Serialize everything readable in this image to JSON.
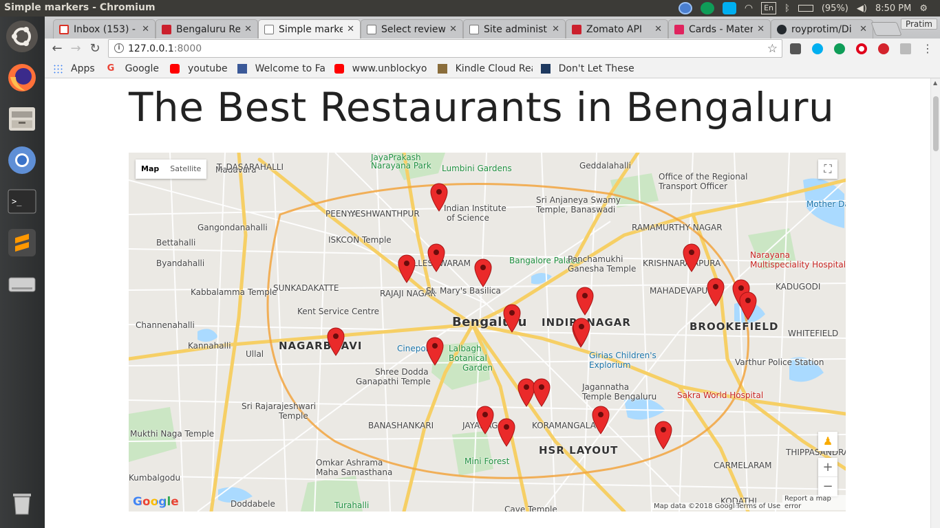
{
  "topbar": {
    "window_title": "Simple markers - Chromium",
    "keyboard": "En",
    "battery": "(95%)",
    "clock": "8:50 PM"
  },
  "tabs": [
    {
      "label": "Inbox (153) - p",
      "color": "#d93025"
    },
    {
      "label": "Bengaluru Re",
      "color": "#cb202d"
    },
    {
      "label": "Simple marke",
      "color": "#ffffff",
      "active": true
    },
    {
      "label": "Select review",
      "color": "#ffffff"
    },
    {
      "label": "Site administ",
      "color": "#ffffff"
    },
    {
      "label": "Zomato API",
      "color": "#cb202d"
    },
    {
      "label": "Cards - Mater",
      "color": "#e0245e"
    },
    {
      "label": "royprotim/Di",
      "color": "#24292e"
    }
  ],
  "profile": "Pratim",
  "address": {
    "host": "127.0.0.1",
    "port": ":8000"
  },
  "bookmarks": [
    {
      "label": "Apps",
      "color": "#4285f4"
    },
    {
      "label": "Google",
      "color": "#ea4335"
    },
    {
      "label": "youtube",
      "color": "#ff0000"
    },
    {
      "label": "Welcome to Face",
      "color": "#3b5998"
    },
    {
      "label": "www.unblockyo",
      "color": "#ff0000"
    },
    {
      "label": "Kindle Cloud Rea",
      "color": "#8a6d3b"
    },
    {
      "label": "Don't Let These",
      "color": "#1f3a60"
    }
  ],
  "page": {
    "title": "The Best Restaurants in Bengaluru"
  },
  "map": {
    "type_control": {
      "map": "Map",
      "satellite": "Satellite"
    },
    "labels": [
      {
        "text": "JayaPrakash",
        "cls": "green"
      },
      {
        "text": "Narayana Park",
        "cls": "green"
      },
      {
        "text": "Lumbini Gardens",
        "cls": "green"
      },
      {
        "text": "Geddalahalli",
        "cls": ""
      },
      {
        "text": "Office of the Regional",
        "cls": ""
      },
      {
        "text": "Transport Officer",
        "cls": ""
      },
      {
        "text": "Madavara",
        "cls": ""
      },
      {
        "text": "T. DASARAHALLI",
        "cls": ""
      },
      {
        "text": "Indian Institute",
        "cls": ""
      },
      {
        "text": "of Science",
        "cls": ""
      },
      {
        "text": "Sri Anjaneya Swamy",
        "cls": ""
      },
      {
        "text": "Temple, Banaswadi",
        "cls": ""
      },
      {
        "text": "Mother Dairy",
        "cls": "blue"
      },
      {
        "text": "Gangondanahalli",
        "cls": ""
      },
      {
        "text": "PEENYA",
        "cls": ""
      },
      {
        "text": "YESHWANTHPUR",
        "cls": ""
      },
      {
        "text": "RAMAMURTHY NAGAR",
        "cls": ""
      },
      {
        "text": "Bettahalli",
        "cls": ""
      },
      {
        "text": "ISKCON Temple",
        "cls": ""
      },
      {
        "text": "Bangalore Palace",
        "cls": "green"
      },
      {
        "text": "Panchamukhi",
        "cls": ""
      },
      {
        "text": "Ganesha Temple",
        "cls": ""
      },
      {
        "text": "Narayana",
        "cls": "red"
      },
      {
        "text": "Multispeciality Hospital",
        "cls": "red"
      },
      {
        "text": "Byandahalli",
        "cls": ""
      },
      {
        "text": "MALLESHWARAM",
        "cls": ""
      },
      {
        "text": "KRISHNARAJAPURA",
        "cls": ""
      },
      {
        "text": "Kabbalamma Temple",
        "cls": ""
      },
      {
        "text": "SUNKADAKATTE",
        "cls": ""
      },
      {
        "text": "RAJAJI NAGAR",
        "cls": ""
      },
      {
        "text": "St. Mary's Basilica",
        "cls": ""
      },
      {
        "text": "MAHADEVAPURA",
        "cls": ""
      },
      {
        "text": "KADUGODI",
        "cls": ""
      },
      {
        "text": "Kent Service Centre",
        "cls": ""
      },
      {
        "text": "Bengaluru",
        "cls": "bigger"
      },
      {
        "text": "INDIRANAGAR",
        "cls": "big"
      },
      {
        "text": "BROOKEFIELD",
        "cls": "big"
      },
      {
        "text": "WHITEFIELD",
        "cls": ""
      },
      {
        "text": "Channenahalli",
        "cls": ""
      },
      {
        "text": "Kannahalli",
        "cls": ""
      },
      {
        "text": "Ullal",
        "cls": ""
      },
      {
        "text": "NAGARBHAVI",
        "cls": "big"
      },
      {
        "text": "Cinepolis",
        "cls": "blue"
      },
      {
        "text": "Lalbagh",
        "cls": "green"
      },
      {
        "text": "Botanical",
        "cls": "green"
      },
      {
        "text": "Garden",
        "cls": "green"
      },
      {
        "text": "Girias Children's",
        "cls": "blue"
      },
      {
        "text": "Explorium",
        "cls": "blue"
      },
      {
        "text": "Varthur Police Station",
        "cls": ""
      },
      {
        "text": "Shree Dodda",
        "cls": ""
      },
      {
        "text": "Ganapathi Temple",
        "cls": ""
      },
      {
        "text": "Jagannatha",
        "cls": ""
      },
      {
        "text": "Temple Bengaluru",
        "cls": ""
      },
      {
        "text": "Sri Rajarajeshwari",
        "cls": ""
      },
      {
        "text": "Temple",
        "cls": ""
      },
      {
        "text": "Sakra World Hospital",
        "cls": "red"
      },
      {
        "text": "BANASHANKARI",
        "cls": ""
      },
      {
        "text": "JAYANAGAR",
        "cls": ""
      },
      {
        "text": "KORAMANGALA",
        "cls": ""
      },
      {
        "text": "Mukthi Naga Temple",
        "cls": ""
      },
      {
        "text": "HSR LAYOUT",
        "cls": "big"
      },
      {
        "text": "THIPPASANDRA",
        "cls": ""
      },
      {
        "text": "Mini Forest",
        "cls": "green"
      },
      {
        "text": "CARMELARAM",
        "cls": ""
      },
      {
        "text": "Omkar Ashrama",
        "cls": ""
      },
      {
        "text": "Maha Samasthana",
        "cls": ""
      },
      {
        "text": "Kumbalgodu",
        "cls": ""
      },
      {
        "text": "Doddabele",
        "cls": ""
      },
      {
        "text": "Turahalli",
        "cls": "green"
      },
      {
        "text": "KODATHI",
        "cls": ""
      },
      {
        "text": "Cave Temple",
        "cls": ""
      }
    ],
    "marker_count": 22,
    "footer": {
      "data": "Map data ©2018 Google",
      "terms": "Terms of Use",
      "report": "Report a map error"
    },
    "logo": "Google",
    "zoom_in": "+",
    "zoom_out": "−"
  }
}
